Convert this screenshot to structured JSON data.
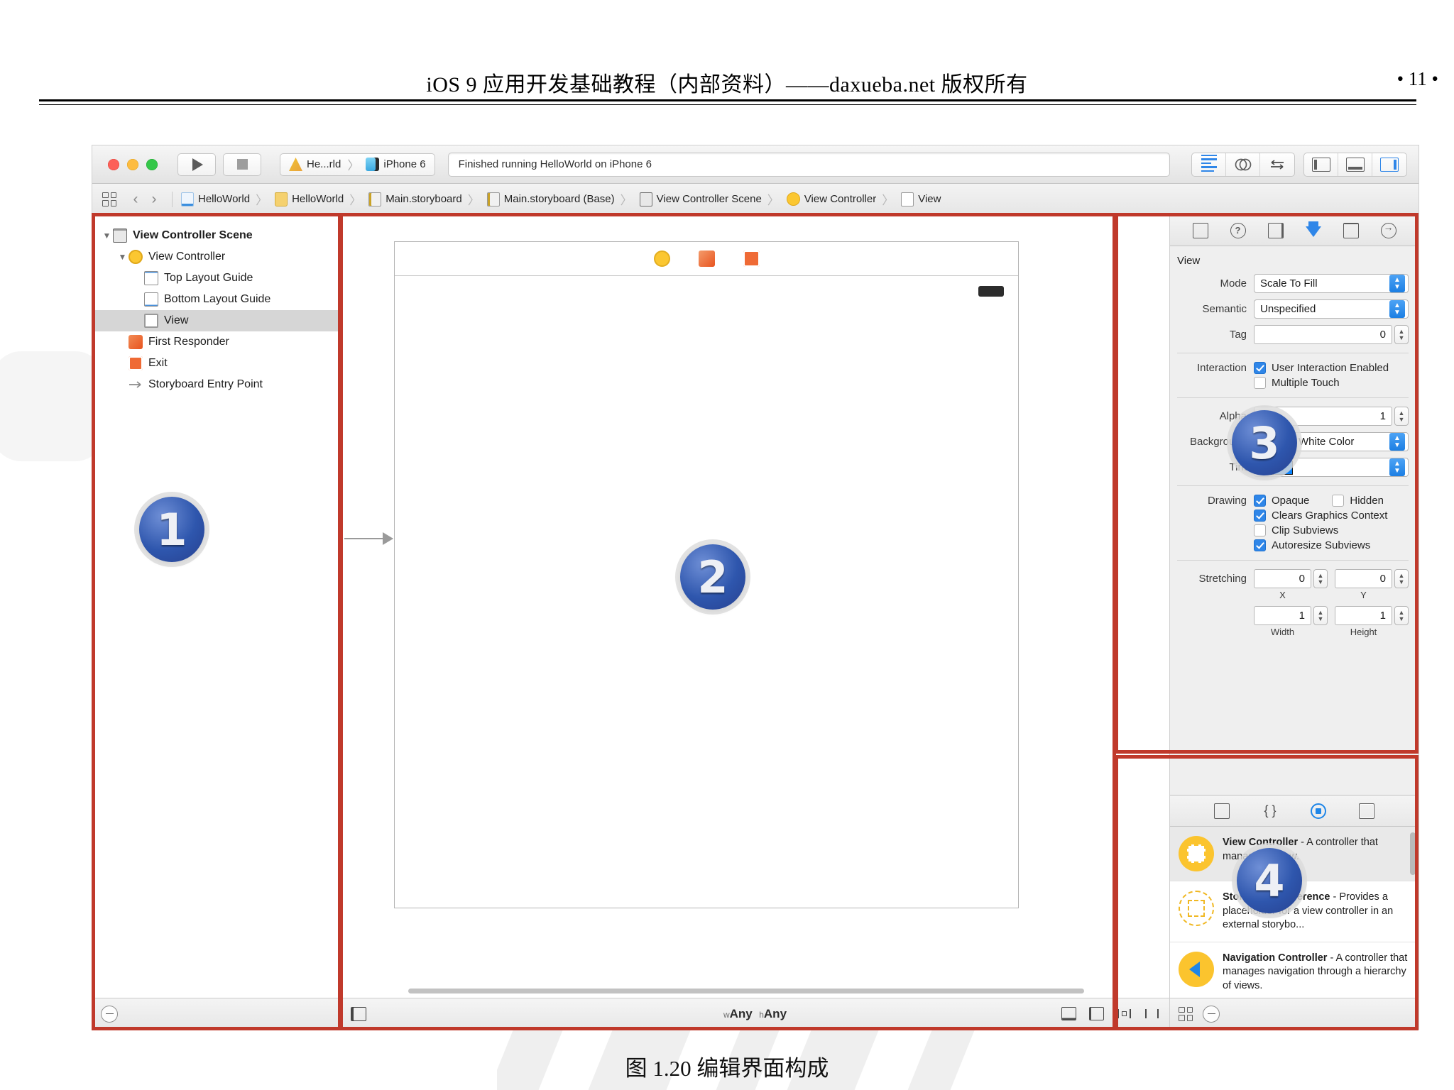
{
  "page": {
    "header_title": "iOS 9 应用开发基础教程（内部资料）——daxueba.net 版权所有",
    "page_number": "• 11 •",
    "caption": "图 1.20   编辑界面构成"
  },
  "toolbar": {
    "scheme_name": "He...rld",
    "scheme_separator": "〉",
    "destination": "iPhone 6",
    "status_text": "Finished running HelloWorld on iPhone 6",
    "icons": {
      "run": "play-icon",
      "stop": "stop-icon",
      "app": "xcode-hammer-icon",
      "device": "iphone-icon",
      "standard_editor": "standard-editor-icon",
      "assistant_editor": "assistant-editor-icon",
      "version_editor": "version-editor-icon",
      "navigator_toggle": "left-panel-icon",
      "debug_toggle": "bottom-panel-icon",
      "utilities_toggle": "right-panel-icon"
    }
  },
  "breadcrumb": {
    "items": [
      {
        "label": "HelloWorld",
        "icon": "project-doc-icon"
      },
      {
        "label": "HelloWorld",
        "icon": "folder-icon"
      },
      {
        "label": "Main.storyboard",
        "icon": "storyboard-icon"
      },
      {
        "label": "Main.storyboard (Base)",
        "icon": "storyboard-icon"
      },
      {
        "label": "View Controller Scene",
        "icon": "scene-icon"
      },
      {
        "label": "View Controller",
        "icon": "view-controller-icon"
      },
      {
        "label": "View",
        "icon": "view-icon"
      }
    ],
    "separator": "〉"
  },
  "navigator": {
    "items": [
      {
        "label": "View Controller Scene",
        "indent": 0,
        "icon": "scene-icon",
        "disclosure": "▼",
        "bold": true,
        "selected": false
      },
      {
        "label": "View Controller",
        "indent": 1,
        "icon": "view-controller-icon",
        "disclosure": "▼",
        "bold": false,
        "selected": false
      },
      {
        "label": "Top Layout Guide",
        "indent": 2,
        "icon": "top-layout-guide-icon",
        "disclosure": "",
        "bold": false,
        "selected": false
      },
      {
        "label": "Bottom Layout Guide",
        "indent": 2,
        "icon": "bottom-layout-guide-icon",
        "disclosure": "",
        "bold": false,
        "selected": false
      },
      {
        "label": "View",
        "indent": 2,
        "icon": "view-icon",
        "disclosure": "",
        "bold": false,
        "selected": true
      },
      {
        "label": "First Responder",
        "indent": 1,
        "icon": "first-responder-icon",
        "disclosure": "",
        "bold": false,
        "selected": false
      },
      {
        "label": "Exit",
        "indent": 1,
        "icon": "exit-icon",
        "disclosure": "",
        "bold": false,
        "selected": false
      },
      {
        "label": "Storyboard Entry Point",
        "indent": 1,
        "icon": "entry-point-arrow-icon",
        "disclosure": "",
        "bold": false,
        "selected": false
      }
    ]
  },
  "canvas": {
    "scene_icons": [
      "view-controller-icon",
      "first-responder-icon",
      "exit-icon"
    ],
    "bottom_bar": {
      "size_class_w_prefix": "w",
      "size_class_w": "Any",
      "size_class_h_prefix": "h",
      "size_class_h": "Any",
      "icons": [
        "resolve-auto-layout-icon",
        "align-icon",
        "pin-icon",
        "resize-icon",
        "document-outline-icon"
      ]
    }
  },
  "inspector": {
    "tabs": [
      "file-inspector-icon",
      "quick-help-icon",
      "identity-inspector-icon",
      "attributes-inspector-icon",
      "size-inspector-icon",
      "connections-inspector-icon"
    ],
    "active_tab_index": 3,
    "section_title": "View",
    "fields": {
      "mode_label": "Mode",
      "mode_value": "Scale To Fill",
      "semantic_label": "Semantic",
      "semantic_value": "Unspecified",
      "tag_label": "Tag",
      "tag_value": "0",
      "interaction_label": "Interaction",
      "user_interaction_enabled": "User Interaction Enabled",
      "multiple_touch": "Multiple Touch",
      "alpha_label": "Alpha",
      "alpha_value": "1",
      "background_label": "Background",
      "background_value": "White Color",
      "tint_label": "Tint",
      "tint_value": "",
      "drawing_label": "Drawing",
      "opaque": "Opaque",
      "hidden": "Hidden",
      "clears_graphics_context": "Clears Graphics Context",
      "clip_subviews": "Clip Subviews",
      "autoresize_subviews": "Autoresize Subviews",
      "stretching_label": "Stretching",
      "stretch_x": "0",
      "stretch_y": "0",
      "stretch_width": "1",
      "stretch_height": "1",
      "sub_x": "X",
      "sub_y": "Y",
      "sub_width": "Width",
      "sub_height": "Height"
    },
    "checkboxes": {
      "user_interaction_enabled": true,
      "multiple_touch": false,
      "opaque": true,
      "hidden": false,
      "clears_graphics_context": true,
      "clip_subviews": false,
      "autoresize_subviews": true
    },
    "colors": {
      "background_swatch": "#ffffff",
      "tint_swatch": "#0a84ff",
      "accent": "#2f86e8"
    }
  },
  "library": {
    "tabs": [
      "file-template-library-icon",
      "code-snippet-library-icon",
      "object-library-icon",
      "media-library-icon"
    ],
    "active_tab_index": 2,
    "items": [
      {
        "icon": "view-controller-library-icon",
        "title": "View Controller",
        "description": " - A controller that manages a view.",
        "selected": true
      },
      {
        "icon": "storyboard-reference-library-icon",
        "title": "Storyboard Reference",
        "description": " - Provides a placeholder for a view controller in an external storybo...",
        "selected": false
      },
      {
        "icon": "navigation-controller-library-icon",
        "title": "Navigation Controller",
        "description": " - A controller that manages navigation through a hierarchy of views.",
        "selected": false
      }
    ]
  },
  "annotations": {
    "badges": [
      {
        "number": "1",
        "region": "navigator"
      },
      {
        "number": "2",
        "region": "canvas"
      },
      {
        "number": "3",
        "region": "inspector"
      },
      {
        "number": "4",
        "region": "library"
      }
    ],
    "box_color": "#c0392b"
  }
}
